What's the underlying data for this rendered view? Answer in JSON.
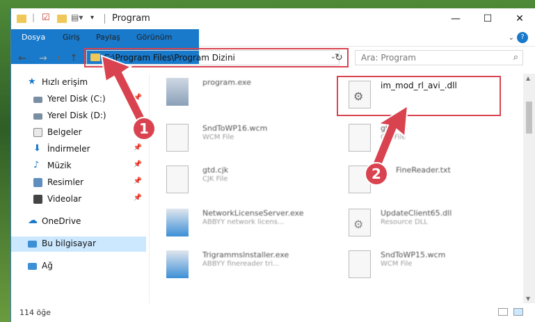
{
  "window": {
    "title": "Program"
  },
  "ribbon": {
    "tabs": [
      "Dosya",
      "Giriş",
      "Paylaş",
      "Görünüm"
    ]
  },
  "nav": {
    "path": "C:\\Program Files\\Program Dizini",
    "search_placeholder": "Ara: Program"
  },
  "sidebar": {
    "items": [
      {
        "label": "Hızlı erişim",
        "icon": "star-icon"
      },
      {
        "label": "Yerel Disk (C:)",
        "icon": "drive-icon",
        "pinned": true
      },
      {
        "label": "Yerel Disk (D:)",
        "icon": "drive-icon"
      },
      {
        "label": "Belgeler",
        "icon": "documents-icon"
      },
      {
        "label": "İndirmeler",
        "icon": "download-icon",
        "pinned": true
      },
      {
        "label": "Müzik",
        "icon": "music-icon",
        "pinned": true
      },
      {
        "label": "Resimler",
        "icon": "pictures-icon",
        "pinned": true
      },
      {
        "label": "Videolar",
        "icon": "videos-icon",
        "pinned": true
      },
      {
        "label": "OneDrive",
        "icon": "cloud-icon"
      },
      {
        "label": "Bu bilgisayar",
        "icon": "computer-icon",
        "selected": true
      },
      {
        "label": "Ağ",
        "icon": "network-icon"
      }
    ]
  },
  "files": [
    {
      "name": "program.exe",
      "type": ""
    },
    {
      "name": "im_mod_rl_avi_.dll",
      "type": ""
    },
    {
      "name": "SndToWP16.wcm",
      "type": "WCM File"
    },
    {
      "name": "gtd",
      "type": "CJK File"
    },
    {
      "name": "gtd.cjk",
      "type": "CJK File"
    },
    {
      "name": "FineReader.txt",
      "type": ""
    },
    {
      "name": "NetworkLicenseServer.exe",
      "type": "ABBYY network licens..."
    },
    {
      "name": "UpdateClient65.dll",
      "type": "Resource DLL"
    },
    {
      "name": "Trigrammslnstaller.exe",
      "type": "ABBYY finereader tri..."
    },
    {
      "name": "SndToWP15.wcm",
      "type": "WCM File"
    }
  ],
  "status": {
    "count": "114 öğe"
  },
  "annotations": [
    "1",
    "2"
  ],
  "colors": {
    "accent": "#1979ca",
    "highlight": "#d9434f",
    "selected": "#cce8ff"
  }
}
